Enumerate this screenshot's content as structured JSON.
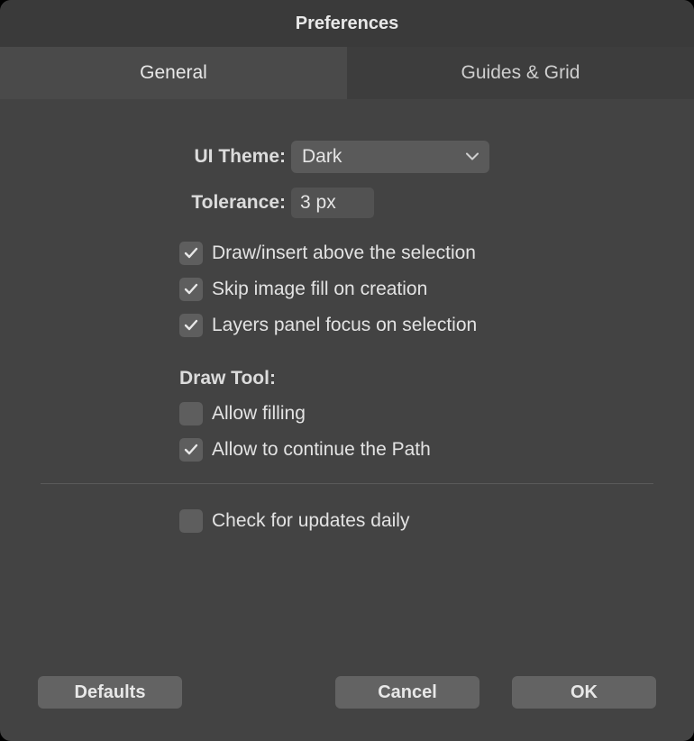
{
  "window": {
    "title": "Preferences"
  },
  "tabs": {
    "general": "General",
    "guides": "Guides & Grid",
    "active": "general"
  },
  "general": {
    "ui_theme_label": "UI Theme:",
    "ui_theme_value": "Dark",
    "tolerance_label": "Tolerance:",
    "tolerance_value": "3 px",
    "checks": {
      "draw_above": {
        "label": "Draw/insert above the selection",
        "checked": true
      },
      "skip_image_fill": {
        "label": "Skip image fill on creation",
        "checked": true
      },
      "layers_focus": {
        "label": "Layers panel focus on selection",
        "checked": true
      }
    },
    "draw_tool_heading": "Draw Tool:",
    "draw_tool": {
      "allow_filling": {
        "label": "Allow filling",
        "checked": false
      },
      "allow_continue": {
        "label": "Allow to continue the Path",
        "checked": true
      }
    },
    "updates": {
      "label": "Check for updates daily",
      "checked": false
    }
  },
  "buttons": {
    "defaults": "Defaults",
    "cancel": "Cancel",
    "ok": "OK"
  },
  "colors": {
    "window_bg": "#434343",
    "titlebar_bg": "#3a3a3a",
    "tab_active_bg": "#4a4a4a",
    "control_bg": "#5e5e5e",
    "button_bg": "#636363",
    "text": "#e3e3e3"
  }
}
